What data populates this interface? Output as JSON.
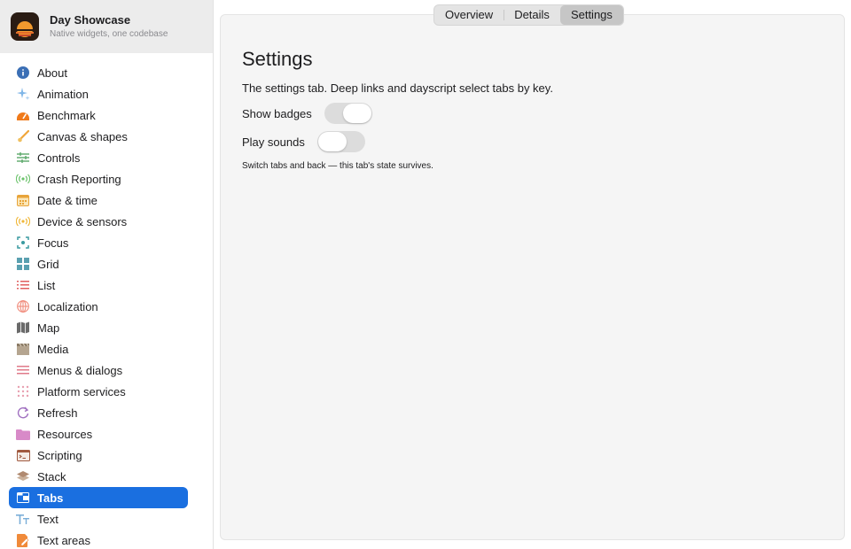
{
  "app": {
    "title": "Day Showcase",
    "subtitle": "Native widgets, one codebase"
  },
  "sidebar": {
    "items": [
      {
        "label": "About",
        "icon": "info-icon",
        "color": "#3b6fb5"
      },
      {
        "label": "Animation",
        "icon": "sparkles-icon",
        "color": "#7fb6e8"
      },
      {
        "label": "Benchmark",
        "icon": "gauge-icon",
        "color": "#f07a1a"
      },
      {
        "label": "Canvas & shapes",
        "icon": "brush-icon",
        "color": "#f0a63a"
      },
      {
        "label": "Controls",
        "icon": "sliders-icon",
        "color": "#5aa86a"
      },
      {
        "label": "Crash Reporting",
        "icon": "broadcast-icon",
        "color": "#6cc36c"
      },
      {
        "label": "Date & time",
        "icon": "calendar-icon",
        "color": "#e8a43a"
      },
      {
        "label": "Device & sensors",
        "icon": "sensor-icon",
        "color": "#f0b83a"
      },
      {
        "label": "Focus",
        "icon": "focus-icon",
        "color": "#3a9aa0"
      },
      {
        "label": "Grid",
        "icon": "grid-icon",
        "color": "#5aa0b0"
      },
      {
        "label": "List",
        "icon": "list-icon",
        "color": "#e06060"
      },
      {
        "label": "Localization",
        "icon": "globe-icon",
        "color": "#f08a7a"
      },
      {
        "label": "Map",
        "icon": "map-icon",
        "color": "#6a6a6a"
      },
      {
        "label": "Media",
        "icon": "clapper-icon",
        "color": "#b5a590"
      },
      {
        "label": "Menus & dialogs",
        "icon": "menu-icon",
        "color": "#e07a8a"
      },
      {
        "label": "Platform services",
        "icon": "dots-grid-icon",
        "color": "#e8a0b0"
      },
      {
        "label": "Refresh",
        "icon": "refresh-icon",
        "color": "#a070c0"
      },
      {
        "label": "Resources",
        "icon": "folder-icon",
        "color": "#d88ac8"
      },
      {
        "label": "Scripting",
        "icon": "terminal-icon",
        "color": "#a05a40"
      },
      {
        "label": "Stack",
        "icon": "layers-icon",
        "color": "#b08a70"
      },
      {
        "label": "Tabs",
        "icon": "tabs-icon",
        "color": "#ffffff",
        "active": true
      },
      {
        "label": "Text",
        "icon": "text-icon",
        "color": "#7aaed8"
      },
      {
        "label": "Text areas",
        "icon": "edit-doc-icon",
        "color": "#f08a3a"
      }
    ]
  },
  "tabs": [
    {
      "label": "Overview"
    },
    {
      "label": "Details"
    },
    {
      "label": "Settings",
      "active": true
    }
  ],
  "panel": {
    "title": "Settings",
    "description": "The settings tab. Deep links and dayscript select tabs by key.",
    "show_badges_label": "Show badges",
    "play_sounds_label": "Play sounds",
    "note": "Switch tabs and back — this tab's state survives."
  },
  "colors": {
    "accent": "#1a6fe0",
    "panel_bg": "#f5f5f5",
    "header_bg": "#ececec"
  }
}
